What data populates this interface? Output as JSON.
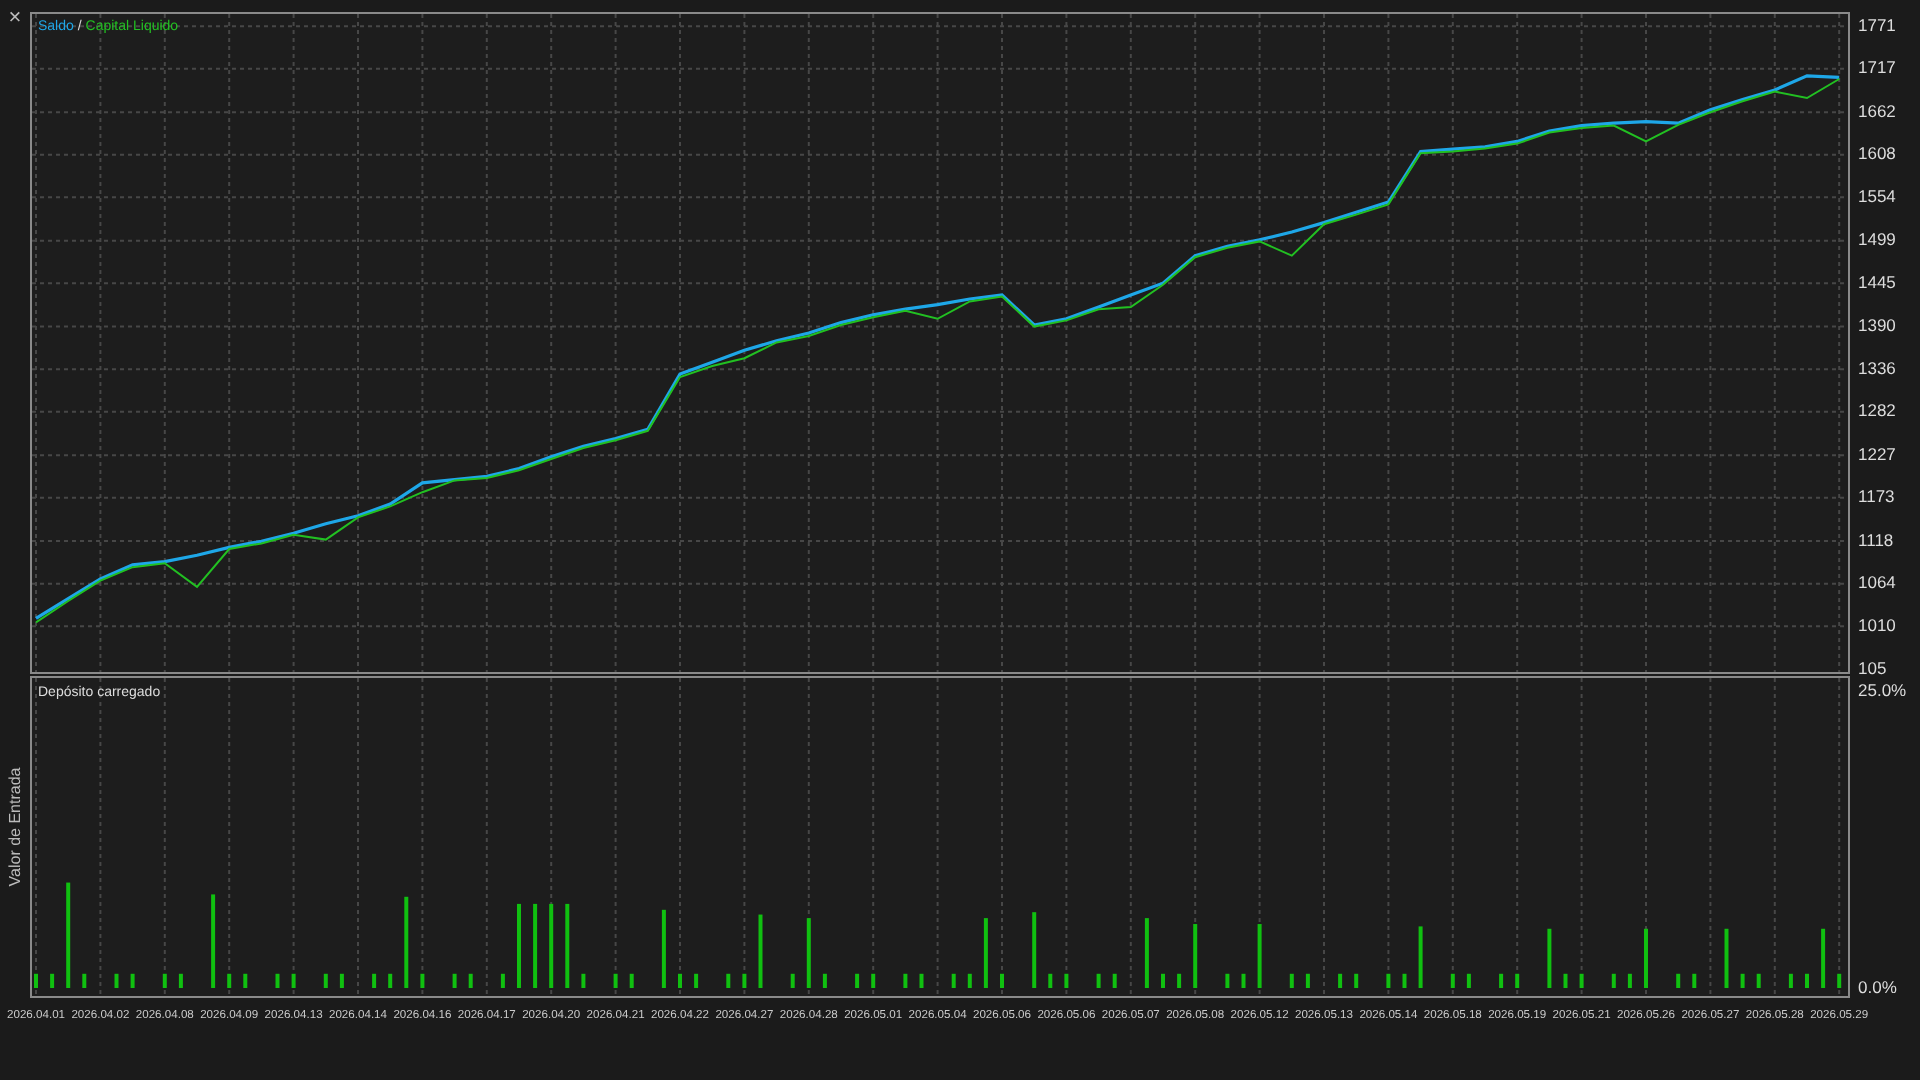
{
  "close_glyph": "×",
  "legend_separator": "/",
  "equity_panel": {
    "chart_data": {
      "type": "line",
      "grid": true,
      "categories": [
        null,
        null,
        null,
        null,
        null,
        null,
        null,
        null,
        null,
        null,
        null,
        null,
        null,
        null,
        null,
        null,
        null,
        null,
        null,
        null,
        null,
        null,
        null,
        null,
        null,
        null,
        null,
        null,
        null,
        null,
        null,
        null,
        null,
        null,
        null,
        null,
        null,
        null,
        null,
        null,
        null,
        null,
        null,
        null,
        null,
        null,
        null,
        null,
        null,
        null,
        null,
        null,
        null,
        null,
        null,
        null,
        null
      ],
      "series": [
        {
          "name": "Saldo",
          "color": "#1ea7e8",
          "values": [
            1020,
            1045,
            1070,
            1088,
            1092,
            1100,
            1110,
            1118,
            1128,
            1140,
            1150,
            1165,
            1192,
            1196,
            1200,
            1210,
            1225,
            1238,
            1248,
            1260,
            1330,
            1345,
            1360,
            1372,
            1382,
            1395,
            1405,
            1412,
            1418,
            1425,
            1430,
            1392,
            1400,
            1415,
            1430,
            1445,
            1480,
            1492,
            1500,
            1510,
            1522,
            1535,
            1548,
            1612,
            1615,
            1618,
            1625,
            1638,
            1645,
            1648,
            1650,
            1648,
            1665,
            1678,
            1690,
            1708,
            1706
          ]
        },
        {
          "name": "Capital Liquido",
          "color": "#22c022",
          "values": [
            1015,
            1042,
            1068,
            1085,
            1090,
            1060,
            1108,
            1115,
            1126,
            1120,
            1148,
            1162,
            1180,
            1195,
            1198,
            1208,
            1222,
            1236,
            1246,
            1258,
            1326,
            1340,
            1350,
            1370,
            1378,
            1392,
            1402,
            1410,
            1400,
            1422,
            1428,
            1390,
            1398,
            1412,
            1415,
            1443,
            1478,
            1490,
            1498,
            1480,
            1520,
            1532,
            1545,
            1610,
            1612,
            1616,
            1622,
            1636,
            1642,
            1645,
            1625,
            1646,
            1662,
            1676,
            1688,
            1680,
            1704
          ]
        }
      ],
      "ylim": [
        952,
        1789
      ],
      "yticks": [
        1771,
        1717,
        1662,
        1608,
        1554,
        1499,
        1445,
        1390,
        1336,
        1282,
        1227,
        1173,
        1118,
        1064,
        1010
      ]
    },
    "cut_tick_label": "105"
  },
  "deposit_panel": {
    "chart_data": {
      "type": "bar",
      "title": "Depósito carregado",
      "ylabel": "Valor de Entrada",
      "grid": true,
      "categories": [
        "2026.04.01",
        null,
        null,
        null,
        "2026.04.02",
        null,
        null,
        null,
        "2026.04.08",
        null,
        null,
        null,
        "2026.04.09",
        null,
        null,
        null,
        "2026.04.13",
        null,
        null,
        null,
        "2026.04.14",
        null,
        null,
        null,
        "2026.04.16",
        null,
        null,
        null,
        "2026.04.17",
        null,
        null,
        null,
        "2026.04.20",
        null,
        null,
        null,
        "2026.04.21",
        null,
        null,
        null,
        "2026.04.22",
        null,
        null,
        null,
        "2026.04.27",
        null,
        null,
        null,
        "2026.04.28",
        null,
        null,
        null,
        "2026.05.01",
        null,
        null,
        null,
        "2026.05.04",
        null,
        null,
        null,
        "2026.05.06",
        null,
        null,
        null,
        "2026.05.06",
        null,
        null,
        null,
        "2026.05.07",
        null,
        null,
        null,
        "2026.05.08",
        null,
        null,
        null,
        "2026.05.12",
        null,
        null,
        null,
        "2026.05.13",
        null,
        null,
        null,
        "2026.05.14",
        null,
        null,
        null,
        "2026.05.18",
        null,
        null,
        null,
        "2026.05.19",
        null,
        null,
        null,
        "2026.05.21",
        null,
        null,
        null,
        "2026.05.26",
        null,
        null,
        null,
        "2026.05.27",
        null,
        null,
        null,
        "2026.05.28",
        null,
        null,
        null,
        "2026.05.29"
      ],
      "series": [
        {
          "color": "#10c010",
          "values": [
            1.2,
            1.2,
            8.9,
            1.2,
            0,
            1.2,
            1.2,
            0,
            1.2,
            1.2,
            0,
            7.9,
            1.2,
            1.2,
            0,
            1.2,
            1.2,
            0,
            1.2,
            1.2,
            0,
            1.2,
            1.2,
            7.7,
            1.2,
            0,
            1.2,
            1.2,
            0,
            1.2,
            7.1,
            7.1,
            7.1,
            7.1,
            1.2,
            0,
            1.2,
            1.2,
            0,
            6.6,
            1.2,
            1.2,
            0,
            1.2,
            1.2,
            6.2,
            0,
            1.2,
            5.9,
            1.2,
            0,
            1.2,
            1.2,
            0,
            1.2,
            1.2,
            0,
            1.2,
            1.2,
            5.9,
            1.2,
            0,
            6.4,
            1.2,
            1.2,
            0,
            1.2,
            1.2,
            0,
            5.9,
            1.2,
            1.2,
            5.4,
            0,
            1.2,
            1.2,
            5.4,
            0,
            1.2,
            1.2,
            0,
            1.2,
            1.2,
            0,
            1.2,
            1.2,
            5.2,
            0,
            1.2,
            1.2,
            0,
            1.2,
            1.2,
            0,
            5.0,
            1.2,
            1.2,
            0,
            1.2,
            1.2,
            5.0,
            0,
            1.2,
            1.2,
            0,
            5.0,
            1.2,
            1.2,
            0,
            1.2,
            1.2,
            5.0,
            1.2
          ]
        }
      ],
      "ylim": [
        0,
        26
      ],
      "yticks": [
        {
          "value": 25,
          "label": "25.0%"
        },
        {
          "value": 0,
          "label": "0.0%"
        }
      ]
    }
  }
}
